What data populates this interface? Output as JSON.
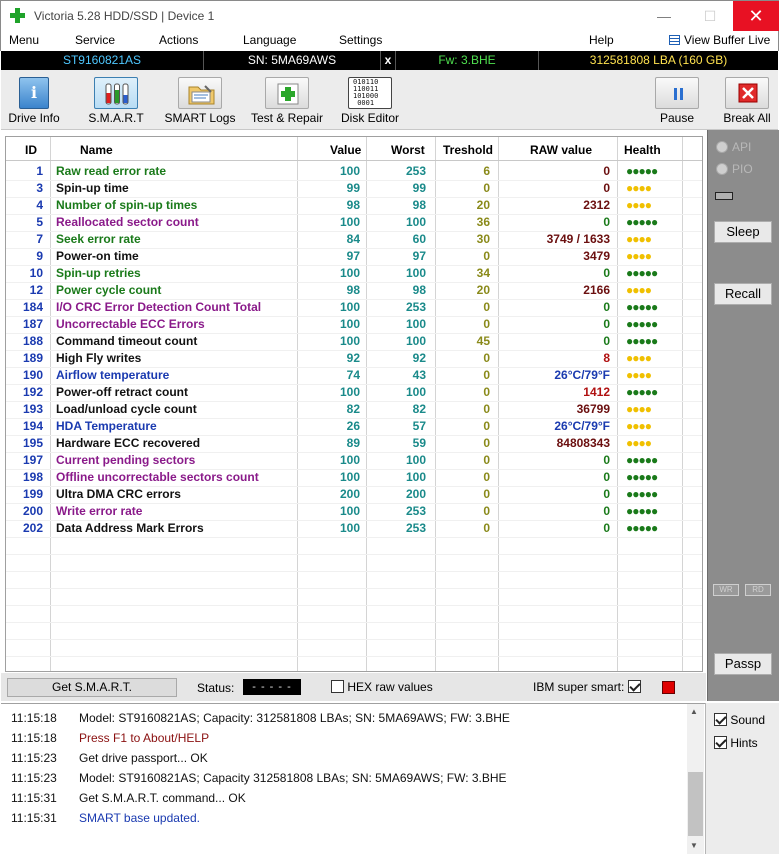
{
  "window": {
    "title": "Victoria 5.28 HDD/SSD | Device 1",
    "minimize": "—",
    "maximize": "☐",
    "close": "✕"
  },
  "menu": {
    "items": [
      "Menu",
      "Service",
      "Actions",
      "Language",
      "Settings",
      "Help"
    ],
    "buffer_live": "View Buffer Live"
  },
  "infobar": {
    "model": "ST9160821AS",
    "serial": "SN: 5MA69AWS",
    "close": "x",
    "firmware": "Fw: 3.BHE",
    "lba": "312581808 LBA (160 GB)",
    "colors": {
      "model": "#4fc8ff",
      "serial": "#ffffff",
      "firmware": "#4fe04f",
      "lba": "#ffe24f"
    }
  },
  "toolbar": {
    "buttons": [
      {
        "label": "Drive Info",
        "icon": "info-icon"
      },
      {
        "label": "S.M.A.R.T",
        "icon": "smart-tubes-icon"
      },
      {
        "label": "SMART Logs",
        "icon": "folder-logs-icon"
      },
      {
        "label": "Test & Repair",
        "icon": "repair-cross-icon"
      },
      {
        "label": "Disk Editor",
        "icon": "binary-editor-icon"
      },
      {
        "label": "Pause",
        "icon": "pause-icon"
      },
      {
        "label": "Break All",
        "icon": "stop-x-icon"
      }
    ],
    "binary_text": [
      "010110",
      "110011",
      "101000",
      "0001"
    ]
  },
  "smart_table": {
    "headers": [
      "ID",
      "Name",
      "Value",
      "Worst",
      "Treshold",
      "RAW value",
      "Health"
    ],
    "rows": [
      {
        "id": "1",
        "name": "Raw read error rate",
        "value": "100",
        "worst": "253",
        "thresh": "6",
        "raw": "0",
        "health": "●●●●●",
        "name_color": "#1a7a1a",
        "raw_color": "#6b0f0f",
        "health_color": "#1a7a1a"
      },
      {
        "id": "3",
        "name": "Spin-up time",
        "value": "99",
        "worst": "99",
        "thresh": "0",
        "raw": "0",
        "health": "●●●●",
        "name_color": "#111111",
        "raw_color": "#6b0f0f",
        "health_color": "#f0c000"
      },
      {
        "id": "4",
        "name": "Number of spin-up times",
        "value": "98",
        "worst": "98",
        "thresh": "20",
        "raw": "2312",
        "health": "●●●●",
        "name_color": "#1a7a1a",
        "raw_color": "#6b0f0f",
        "health_color": "#f0c000"
      },
      {
        "id": "5",
        "name": "Reallocated sector count",
        "value": "100",
        "worst": "100",
        "thresh": "36",
        "raw": "0",
        "health": "●●●●●",
        "name_color": "#8a1a8a",
        "raw_color": "#1a7a1a",
        "health_color": "#1a7a1a"
      },
      {
        "id": "7",
        "name": "Seek error rate",
        "value": "84",
        "worst": "60",
        "thresh": "30",
        "raw": "3749 / 1633",
        "health": "●●●●",
        "name_color": "#1a7a1a",
        "raw_color": "#6b0f0f",
        "health_color": "#f0c000"
      },
      {
        "id": "9",
        "name": "Power-on time",
        "value": "97",
        "worst": "97",
        "thresh": "0",
        "raw": "3479",
        "health": "●●●●",
        "name_color": "#111111",
        "raw_color": "#6b0f0f",
        "health_color": "#f0c000"
      },
      {
        "id": "10",
        "name": "Spin-up retries",
        "value": "100",
        "worst": "100",
        "thresh": "34",
        "raw": "0",
        "health": "●●●●●",
        "name_color": "#1a7a1a",
        "raw_color": "#1a7a1a",
        "health_color": "#1a7a1a"
      },
      {
        "id": "12",
        "name": "Power cycle count",
        "value": "98",
        "worst": "98",
        "thresh": "20",
        "raw": "2166",
        "health": "●●●●",
        "name_color": "#1a7a1a",
        "raw_color": "#6b0f0f",
        "health_color": "#f0c000"
      },
      {
        "id": "184",
        "name": "I/O CRC Error Detection Count Total",
        "value": "100",
        "worst": "253",
        "thresh": "0",
        "raw": "0",
        "health": "●●●●●",
        "name_color": "#8a1a8a",
        "raw_color": "#1a7a1a",
        "health_color": "#1a7a1a"
      },
      {
        "id": "187",
        "name": "Uncorrectable ECC Errors",
        "value": "100",
        "worst": "100",
        "thresh": "0",
        "raw": "0",
        "health": "●●●●●",
        "name_color": "#8a1a8a",
        "raw_color": "#1a7a1a",
        "health_color": "#1a7a1a"
      },
      {
        "id": "188",
        "name": "Command timeout count",
        "value": "100",
        "worst": "100",
        "thresh": "45",
        "raw": "0",
        "health": "●●●●●",
        "name_color": "#111111",
        "raw_color": "#1a7a1a",
        "health_color": "#1a7a1a"
      },
      {
        "id": "189",
        "name": "High Fly writes",
        "value": "92",
        "worst": "92",
        "thresh": "0",
        "raw": "8",
        "health": "●●●●",
        "name_color": "#111111",
        "raw_color": "#b01010",
        "health_color": "#f0c000"
      },
      {
        "id": "190",
        "name": "Airflow temperature",
        "value": "74",
        "worst": "43",
        "thresh": "0",
        "raw": "26°C/79°F",
        "health": "●●●●",
        "name_color": "#1a3ab0",
        "raw_color": "#1a3ab0",
        "health_color": "#f0c000"
      },
      {
        "id": "192",
        "name": "Power-off retract count",
        "value": "100",
        "worst": "100",
        "thresh": "0",
        "raw": "1412",
        "health": "●●●●●",
        "name_color": "#111111",
        "raw_color": "#b01010",
        "health_color": "#1a7a1a"
      },
      {
        "id": "193",
        "name": "Load/unload cycle count",
        "value": "82",
        "worst": "82",
        "thresh": "0",
        "raw": "36799",
        "health": "●●●●",
        "name_color": "#111111",
        "raw_color": "#6b0f0f",
        "health_color": "#f0c000"
      },
      {
        "id": "194",
        "name": "HDA Temperature",
        "value": "26",
        "worst": "57",
        "thresh": "0",
        "raw": "26°C/79°F",
        "health": "●●●●",
        "name_color": "#1a3ab0",
        "raw_color": "#1a3ab0",
        "health_color": "#f0c000"
      },
      {
        "id": "195",
        "name": "Hardware ECC recovered",
        "value": "89",
        "worst": "59",
        "thresh": "0",
        "raw": "84808343",
        "health": "●●●●",
        "name_color": "#111111",
        "raw_color": "#6b0f0f",
        "health_color": "#f0c000"
      },
      {
        "id": "197",
        "name": "Current pending sectors",
        "value": "100",
        "worst": "100",
        "thresh": "0",
        "raw": "0",
        "health": "●●●●●",
        "name_color": "#8a1a8a",
        "raw_color": "#1a7a1a",
        "health_color": "#1a7a1a"
      },
      {
        "id": "198",
        "name": "Offline uncorrectable sectors count",
        "value": "100",
        "worst": "100",
        "thresh": "0",
        "raw": "0",
        "health": "●●●●●",
        "name_color": "#8a1a8a",
        "raw_color": "#1a7a1a",
        "health_color": "#1a7a1a"
      },
      {
        "id": "199",
        "name": "Ultra DMA CRC errors",
        "value": "200",
        "worst": "200",
        "thresh": "0",
        "raw": "0",
        "health": "●●●●●",
        "name_color": "#111111",
        "raw_color": "#1a7a1a",
        "health_color": "#1a7a1a"
      },
      {
        "id": "200",
        "name": "Write error rate",
        "value": "100",
        "worst": "253",
        "thresh": "0",
        "raw": "0",
        "health": "●●●●●",
        "name_color": "#8a1a8a",
        "raw_color": "#1a7a1a",
        "health_color": "#1a7a1a"
      },
      {
        "id": "202",
        "name": "Data Address Mark Errors",
        "value": "100",
        "worst": "253",
        "thresh": "0",
        "raw": "0",
        "health": "●●●●●",
        "name_color": "#111111",
        "raw_color": "#1a7a1a",
        "health_color": "#1a7a1a"
      }
    ]
  },
  "sidepanel": {
    "radio_api": "API",
    "radio_pio": "PIO",
    "sleep": "Sleep",
    "recall": "Recall",
    "passp": "Passp",
    "tiny_left": "WR",
    "tiny_right": "RD"
  },
  "statusbar": {
    "get_smart": "Get S.M.A.R.T.",
    "status_label": "Status:",
    "status_value": "- - - - -",
    "hex_raw": "HEX raw values",
    "hex_checked": false,
    "ibm_super_smart": "IBM super smart:",
    "ibm_checked": true
  },
  "log": {
    "lines": [
      {
        "time": "11:15:18",
        "text": "Model: ST9160821AS; Capacity: 312581808 LBAs; SN: 5MA69AWS; FW: 3.BHE",
        "color": "#111111"
      },
      {
        "time": "11:15:18",
        "text": "Press F1 to About/HELP",
        "color": "#8a1010"
      },
      {
        "time": "11:15:23",
        "text": "Get drive passport... OK",
        "color": "#111111"
      },
      {
        "time": "11:15:23",
        "text": "Model: ST9160821AS; Capacity 312581808 LBAs; SN: 5MA69AWS; FW: 3.BHE",
        "color": "#111111"
      },
      {
        "time": "11:15:31",
        "text": "Get S.M.A.R.T. command... OK",
        "color": "#111111"
      },
      {
        "time": "11:15:31",
        "text": "SMART base updated.",
        "color": "#1a3ab0"
      }
    ]
  },
  "options": {
    "sound": "Sound",
    "sound_checked": true,
    "hints": "Hints",
    "hints_checked": true
  }
}
